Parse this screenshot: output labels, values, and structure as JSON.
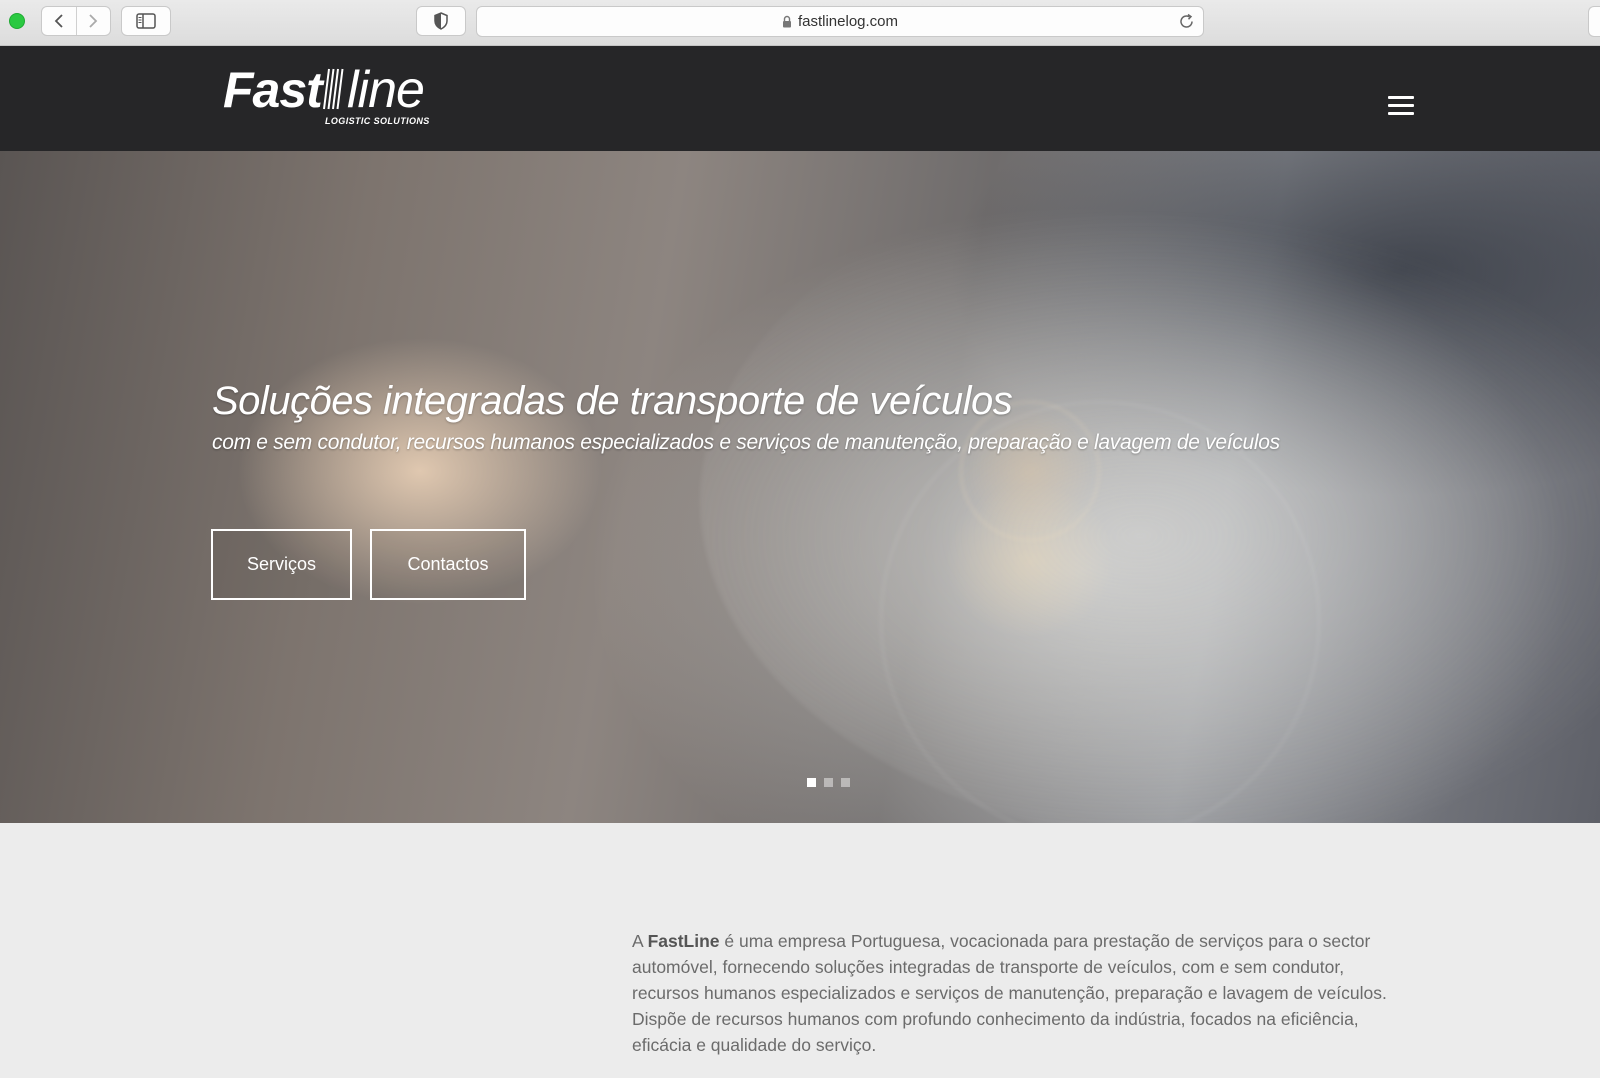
{
  "browser": {
    "url": "fastlinelog.com"
  },
  "header": {
    "logo_main": "Fast",
    "logo_second": "line",
    "logo_tagline": "LOGISTIC SOLUTIONS"
  },
  "hero": {
    "title": "Soluções integradas de transporte de veículos",
    "subtitle": "com e sem condutor, recursos humanos especializados e serviços de manutenção, preparação e lavagem de veículos",
    "buttons": [
      {
        "label": "Serviços"
      },
      {
        "label": "Contactos"
      }
    ],
    "slides_total": 3,
    "active_slide": 1
  },
  "about": {
    "line1_prefix": "A ",
    "line1_brand": "FastLine",
    "line1_rest": " é uma empresa Portuguesa, vocacionada para prestação de serviços para o sector",
    "line2": "automóvel, fornecendo soluções integradas de transporte de veículos, com e sem condutor,",
    "line3": "recursos humanos especializados e serviços de manutenção, preparação e lavagem de veículos.",
    "line4": "Dispõe de recursos humanos com profundo conhecimento da indústria, focados na eficiência,",
    "line5": "eficácia e qualidade do serviço."
  }
}
